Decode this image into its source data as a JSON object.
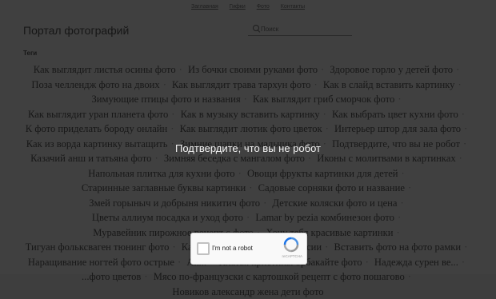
{
  "nav": [
    "Заглавная",
    "Гифки",
    "Фото",
    "Контакты"
  ],
  "site_title": "Портал фотографий",
  "search": {
    "placeholder": "Поиск"
  },
  "tags_heading": "Теги",
  "tags": [
    "Как выглядит листья осины фото",
    "Из бочки своими руками фото",
    "Здоровое горло у детей фото",
    "Поза челлендж фото на двоих",
    "Как выглядит трава тархун фото",
    "Как в слайд вставить картинку",
    "Зимующие птицы фото и названия",
    "Как выглядит гриб сморчок фото",
    "Как выглядит уран планета фото",
    "Как в музыку вставить картинку",
    "Как выбрать цвет кухни фото",
    "К фото приделать бороду онлайн",
    "Как выглядит лютик фото цветок",
    "Интерьер штор для зала фото",
    "Как из ворда картинку вытащить",
    "Зимние шапки на мальчика фото",
    "Подтвердите, что вы не робот",
    "Казачий анш и татьяна фото",
    "Зимняя беседка с мангалом фото",
    "Иконы с молитвами в картинках",
    "Напольная плитка для кухни фото",
    "Овощи фрукты картинки для детей",
    "Старинные заглавные буквы картинки",
    "Садовые сорняки фото и название",
    "Змей горыныч и добрыня никитич фото",
    "Детские коляски фото и цена",
    "Цветы аллиум посадка и уход фото",
    "Lamar by pezia комбинезон фото",
    "Муравейник пирожное рецепт с фото",
    "Хочу тебя красивые картинки",
    "Тигуан фольксваген тюнинг фото",
    "Картинки флага с гербом россии",
    "Вставить фото на фото рамки",
    "Наращивание ногтей фото острые",
    "Ак...",
    "Платья кристины орбакайте фото",
    "Надежда сурен ве...",
    "...фото цветов",
    "Мясо по-французски с картошкой рецепт с фото пошагово",
    "Новиков александр жена дети фото"
  ],
  "overlay_text": "Подтвердите, что вы не робот",
  "captcha": {
    "label": "I'm not a robot",
    "brand": "reCAPTCHA"
  }
}
